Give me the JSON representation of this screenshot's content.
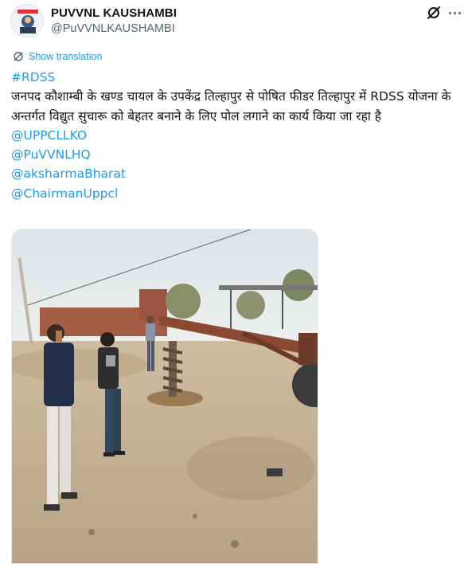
{
  "author": {
    "name": "PUVVNL KAUSHAMBI",
    "handle": "@PuVVNLKAUSHAMBI"
  },
  "translate": {
    "label": "Show translation"
  },
  "post": {
    "hashtag": "#RDSS",
    "text": "जनपद कौशाम्बी के खण्ड चायल के उपकेंद्र तिल्हापुर से पोषित फीडर तिल्हापुर में RDSS योजना के अन्तर्गत विद्युत सुचारू को बेहतर बनाने के लिए पोल लगाने का कार्य किया जा रहा है",
    "mentions": [
      "@UPPCLLKO",
      "@PuVVNLHQ",
      "@aksharmaBharat",
      "@ChairmanUppcl"
    ]
  },
  "icons": {
    "grok": "grok-icon",
    "more": "more-options-icon",
    "translate": "translate-icon",
    "avatar": "avatar-image",
    "photo": "post-photo"
  },
  "colors": {
    "link": "#1d9bf0",
    "text": "#0f1419",
    "muted": "#536471"
  }
}
